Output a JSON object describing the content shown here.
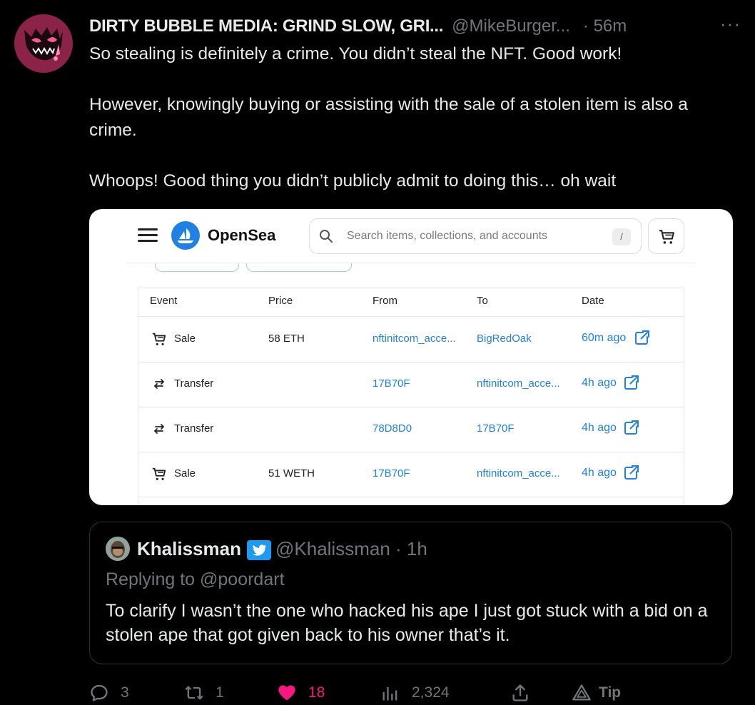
{
  "author": {
    "display_name": "DIRTY BUBBLE MEDIA: GRIND SLOW, GRI...",
    "handle": "@MikeBurger...",
    "time": "· 56m"
  },
  "more_icon": "···",
  "tweet": {
    "paragraphs": [
      "So stealing is definitely a crime. You didn’t steal the NFT. Good work!",
      "However, knowingly buying or assisting with the sale of a stolen item is also a crime.",
      "Whoops! Good thing you didn’t publicly admit to doing this… oh wait"
    ]
  },
  "media": {
    "brand": "OpenSea",
    "search_placeholder": "Search items, collections, and accounts",
    "search_shortcut": "/",
    "columns": [
      "Event",
      "Price",
      "From",
      "To",
      "Date"
    ],
    "rows": [
      {
        "event": "Sale",
        "icon": "cart-icon",
        "price": "58 ETH",
        "from": "nftinitcom_acce...",
        "to": "BigRedOak",
        "date": "60m ago"
      },
      {
        "event": "Transfer",
        "icon": "transfer-icon",
        "price": "",
        "from": "17B70F",
        "to": "nftinitcom_acce...",
        "date": "4h ago"
      },
      {
        "event": "Transfer",
        "icon": "transfer-icon",
        "price": "",
        "from": "78D8D0",
        "to": "17B70F",
        "date": "4h ago"
      },
      {
        "event": "Sale",
        "icon": "cart-icon",
        "price": "51 WETH",
        "from": "17B70F",
        "to": "nftinitcom_acce...",
        "date": "4h ago"
      }
    ]
  },
  "quote": {
    "name": "Khalissman",
    "handle": "@Khalissman · 1h",
    "replying": "Replying to @poordart",
    "text": "To clarify I wasn’t the one who hacked his ape I just got stuck with a bid on a stolen ape that got given back to his owner that’s it."
  },
  "actions": {
    "replies": "3",
    "retweets": "1",
    "likes": "18",
    "views": "2,324",
    "tip_label": "Tip"
  },
  "colors": {
    "background": "#000000",
    "text": "#e7e9ea",
    "muted": "#71767b",
    "like": "#f91880",
    "link": "#2081e2"
  }
}
